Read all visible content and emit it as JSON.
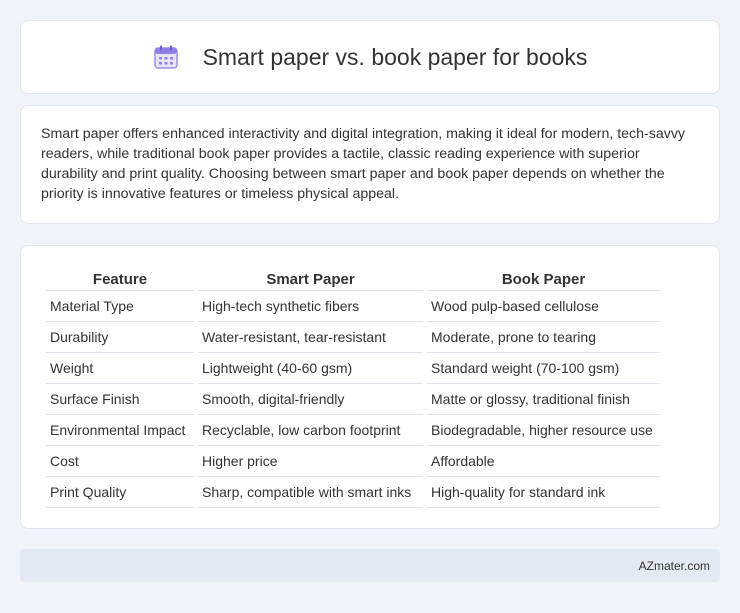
{
  "header": {
    "icon": "calendar-icon",
    "title": "Smart paper vs. book paper for books"
  },
  "description": "Smart paper offers enhanced interactivity and digital integration, making it ideal for modern, tech-savvy readers, while traditional book paper provides a tactile, classic reading experience with superior durability and print quality. Choosing between smart paper and book paper depends on whether the priority is innovative features or timeless physical appeal.",
  "table": {
    "headers": [
      "Feature",
      "Smart Paper",
      "Book Paper"
    ],
    "rows": [
      [
        "Material Type",
        "High-tech synthetic fibers",
        "Wood pulp-based cellulose"
      ],
      [
        "Durability",
        "Water-resistant, tear-resistant",
        "Moderate, prone to tearing"
      ],
      [
        "Weight",
        "Lightweight (40-60 gsm)",
        "Standard weight (70-100 gsm)"
      ],
      [
        "Surface Finish",
        "Smooth, digital-friendly",
        "Matte or glossy, traditional finish"
      ],
      [
        "Environmental Impact",
        "Recyclable, low carbon footprint",
        "Biodegradable, higher resource use"
      ],
      [
        "Cost",
        "Higher price",
        "Affordable"
      ],
      [
        "Print Quality",
        "Sharp, compatible with smart inks",
        "High-quality for standard ink"
      ]
    ]
  },
  "footer": {
    "brand": "AZmater.com"
  }
}
